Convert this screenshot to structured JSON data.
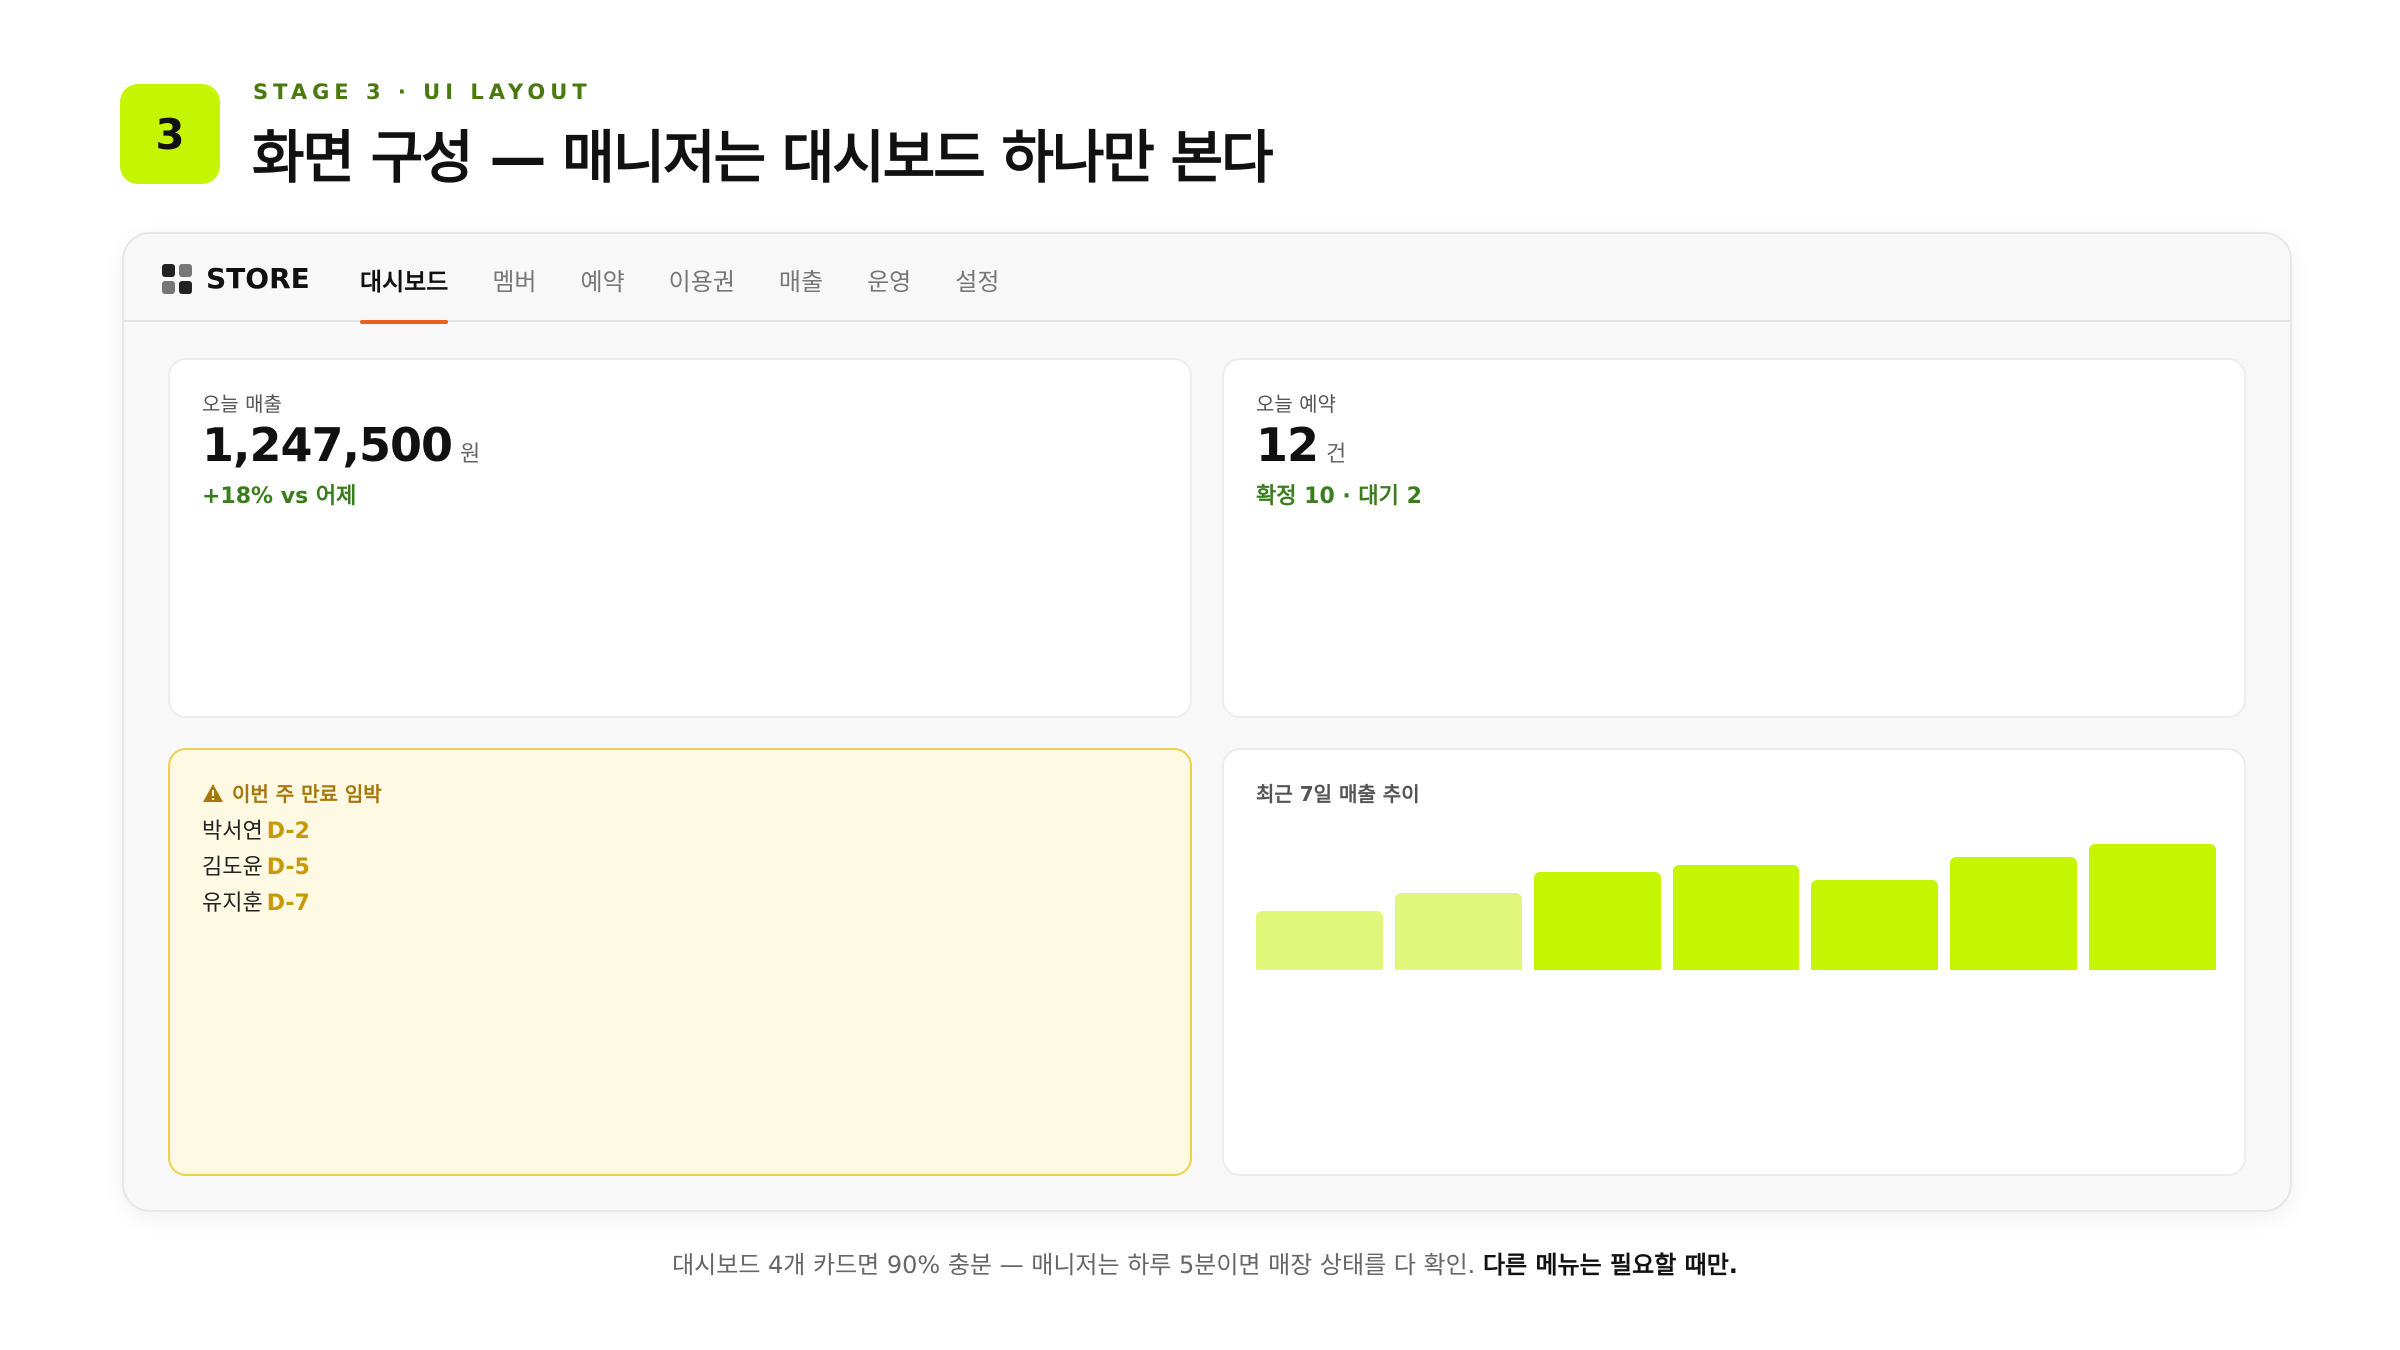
{
  "header": {
    "stage_number": "3",
    "eyebrow": "STAGE 3 · UI LAYOUT",
    "title": "화면 구성 — 매니저는 대시보드 하나만 본다"
  },
  "app": {
    "brand": "STORE",
    "brand_icon": "grid-icon",
    "accent_color": "#e8601c",
    "tabs": [
      {
        "label": "대시보드",
        "active": true
      },
      {
        "label": "멤버",
        "active": false
      },
      {
        "label": "예약",
        "active": false
      },
      {
        "label": "이용권",
        "active": false
      },
      {
        "label": "매출",
        "active": false
      },
      {
        "label": "운영",
        "active": false
      },
      {
        "label": "설정",
        "active": false
      }
    ]
  },
  "cards": {
    "revenue": {
      "label": "오늘 매출",
      "value": "1,247,500",
      "unit": "원",
      "delta": "+18% vs 어제"
    },
    "booking": {
      "label": "오늘 예약",
      "value": "12",
      "unit": "건",
      "detail": "확정 10 · 대기 2"
    },
    "expiry": {
      "title": "이번 주 만료 임박",
      "icon": "warning-icon",
      "items": [
        {
          "name": "박서연",
          "dday": "D-2"
        },
        {
          "name": "김도윤",
          "dday": "D-5"
        },
        {
          "name": "유지훈",
          "dday": "D-7"
        }
      ]
    },
    "trend": {
      "title": "최근 7일 매출 추이",
      "bars": [
        {
          "level": 0.42,
          "color": "#e0f77a"
        },
        {
          "level": 0.55,
          "color": "#e0f77a"
        },
        {
          "level": 0.7,
          "color": "#c6f500"
        },
        {
          "level": 0.75,
          "color": "#c6f500"
        },
        {
          "level": 0.64,
          "color": "#c6f500"
        },
        {
          "level": 0.81,
          "color": "#c6f500"
        },
        {
          "level": 0.9,
          "color": "#c6f500"
        }
      ]
    }
  },
  "footnote": {
    "text": "대시보드 4개 카드면 90% 충분 — 매니저는 하루 5분이면 매장 상태를 다 확인. ",
    "emphasis": "다른 메뉴는 필요할 때만."
  }
}
